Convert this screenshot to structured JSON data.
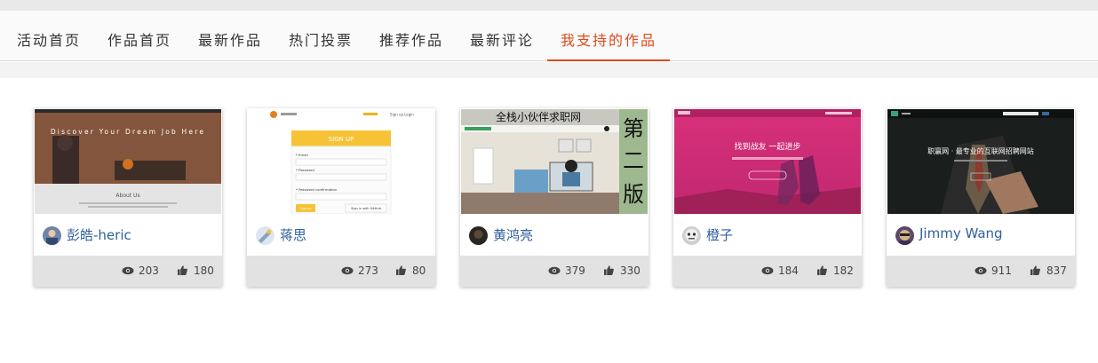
{
  "tabs": [
    {
      "label": "活动首页"
    },
    {
      "label": "作品首页"
    },
    {
      "label": "最新作品"
    },
    {
      "label": "热门投票"
    },
    {
      "label": "推荐作品"
    },
    {
      "label": "最新评论"
    },
    {
      "label": "我支持的作品",
      "active": true
    }
  ],
  "colors": {
    "accent": "#e04a1c",
    "author_link": "#2f5f9e",
    "stats_bg": "#e2e2e2"
  },
  "cards": [
    {
      "author": "彭皓-heric",
      "views": "203",
      "likes": "180",
      "thumb": {
        "hero_text": "Discover Your Dream Job Here",
        "section_title": "About Us"
      }
    },
    {
      "author": "蒋思",
      "views": "273",
      "likes": "80",
      "thumb": {
        "title": "SIGN UP",
        "email_label": "* Email",
        "password_label": "* Password",
        "confirm_label": "* Password confirmation",
        "submit": "Sign up",
        "github_button": "Sign in with GitHub",
        "nav_signup": "Sign up",
        "nav_login": "Login"
      }
    },
    {
      "author": "黄鸿亮",
      "views": "379",
      "likes": "330",
      "thumb": {
        "banner": "全栈小伙伴求职网",
        "badge_line1": "第",
        "badge_line2": "二",
        "badge_line3": "版"
      }
    },
    {
      "author": "橙子",
      "views": "184",
      "likes": "182",
      "thumb": {
        "headline": "找到战友 一起进步"
      }
    },
    {
      "author": "Jimmy Wang",
      "views": "911",
      "likes": "837",
      "thumb": {
        "headline": "职赢网 · 最专业的互联网招聘网站"
      }
    }
  ]
}
